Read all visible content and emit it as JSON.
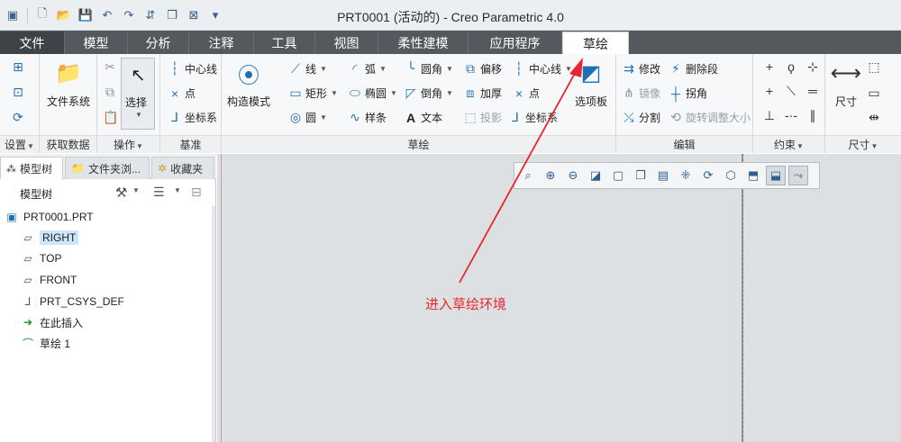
{
  "window": {
    "title": "PRT0001 (活动的) - Creo Parametric 4.0"
  },
  "quick_access": [
    "window-icon",
    "new-icon",
    "open-icon",
    "save-icon",
    "undo-icon",
    "redo-icon",
    "regenerate-icon",
    "windows-icon",
    "close-icon",
    "customize-icon"
  ],
  "tabs": [
    {
      "label": "文件"
    },
    {
      "label": "模型"
    },
    {
      "label": "分析"
    },
    {
      "label": "注释"
    },
    {
      "label": "工具"
    },
    {
      "label": "视图"
    },
    {
      "label": "柔性建模"
    },
    {
      "label": "应用程序"
    },
    {
      "label": "草绘"
    }
  ],
  "ribbon": {
    "setup": {
      "label": "设置"
    },
    "get_data": {
      "file_system": "文件系统",
      "label": "获取数据"
    },
    "operations": {
      "select": "选择",
      "label": "操作"
    },
    "datum": {
      "centerline": "中心线",
      "point": "点",
      "csys": "坐标系",
      "label": "基准"
    },
    "construction_mode": "构造模式",
    "sketch": {
      "line": "线",
      "arc": "弧",
      "fillet": "圆角",
      "offset": "偏移",
      "centerline": "中心线",
      "rectangle": "矩形",
      "ellipse": "椭圆",
      "chamfer": "倒角",
      "thicken": "加厚",
      "point": "点",
      "circle": "圆",
      "spline": "样条",
      "text": "文本",
      "project": "投影",
      "csys": "坐标系",
      "palette": "选项板",
      "label": "草绘"
    },
    "edit": {
      "modify": "修改",
      "delete_segment": "删除段",
      "mirror": "镜像",
      "corner": "拐角",
      "divide": "分割",
      "rotate_resize": "旋转调整大小",
      "label": "编辑"
    },
    "constrain": {
      "label": "约束"
    },
    "dimension": {
      "dimension": "尺寸",
      "label": "尺寸"
    }
  },
  "panel": {
    "tabs": [
      {
        "label": "模型树"
      },
      {
        "label": "文件夹浏..."
      },
      {
        "label": "收藏夹"
      }
    ],
    "title": "模型树",
    "tree": [
      {
        "label": "PRT0001.PRT"
      },
      {
        "label": "RIGHT"
      },
      {
        "label": "TOP"
      },
      {
        "label": "FRONT"
      },
      {
        "label": "PRT_CSYS_DEF"
      },
      {
        "label": "在此插入"
      },
      {
        "label": "草绘 1"
      }
    ]
  },
  "annotation": {
    "text": "进入草绘环境",
    "color": "#e8262d"
  },
  "colors": {
    "tab_bar": "#54595e",
    "accent": "#1f6fb3",
    "graphics_bg": "#dde0e3",
    "highlight": "#cfe5fa"
  }
}
